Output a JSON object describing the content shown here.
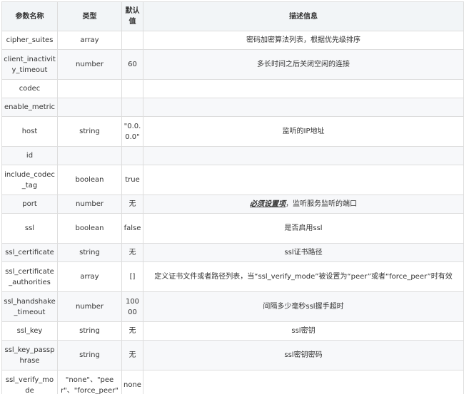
{
  "headers": [
    "参数名称",
    "类型",
    "默认值",
    "描述信息"
  ],
  "rows": [
    {
      "name": "cipher_suites",
      "type": "array",
      "default": "",
      "desc": "密码加密算法列表，根据优先级排序"
    },
    {
      "name": "client_inactivity_timeout",
      "type": "number",
      "default": "60",
      "desc": "多长时间之后关闭空闲的连接"
    },
    {
      "name": "codec",
      "type": "",
      "default": "",
      "desc": ""
    },
    {
      "name": "enable_metric",
      "type": "",
      "default": "",
      "desc": ""
    },
    {
      "name": "host",
      "type": "string",
      "default": "\"0.0.0.0\"",
      "desc": "监听的IP地址"
    },
    {
      "name": "id",
      "type": "",
      "default": "",
      "desc": ""
    },
    {
      "name": "include_codec_tag",
      "type": "boolean",
      "default": "true",
      "desc": ""
    },
    {
      "name": "port",
      "type": "number",
      "default": "无",
      "desc_emph": "必须设置项",
      "desc": "，监听服务监听的端口"
    },
    {
      "name": "ssl",
      "type": "boolean",
      "default": "false",
      "desc": "是否启用ssl"
    },
    {
      "name": "ssl_certificate",
      "type": "string",
      "default": "无",
      "desc": "ssl证书路径"
    },
    {
      "name": "ssl_certificate_authorities",
      "type": "array",
      "default": "[]",
      "desc": "定义证书文件或者路径列表，当“ssl_verify_mode”被设置为“peer”或者“force_peer”时有效"
    },
    {
      "name": "ssl_handshake_timeout",
      "type": "number",
      "default": "10000",
      "desc": "间隔多少毫秒ssl握手超时"
    },
    {
      "name": "ssl_key",
      "type": "string",
      "default": "无",
      "desc": "ssl密钥"
    },
    {
      "name": "ssl_key_passphrase",
      "type": "string",
      "default": "无",
      "desc": "ssl密钥密码"
    },
    {
      "name": "ssl_verify_mode",
      "type": "\"none\"、\"peer\"、\"force_peer\"",
      "default": "none",
      "desc": ""
    }
  ]
}
